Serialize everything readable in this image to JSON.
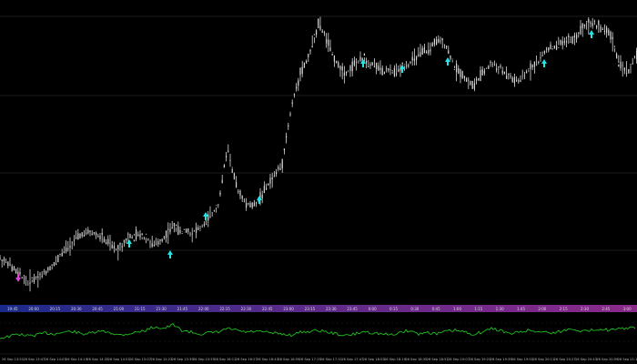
{
  "window": {
    "title": ""
  },
  "colors": {
    "background": "#000000",
    "grid": "#3a3a3a",
    "candle": "#d9d9d9",
    "signal_up": "#22e6e6",
    "signal_down": "#e040e0",
    "oscillator": "#1fbf1f",
    "timeband_start": "#1a2a8a",
    "timeband_end": "#8a2a8a",
    "axis_text": "#bbbbbb"
  },
  "chart_data": [
    {
      "type": "line",
      "title": "",
      "series": [
        {
          "x": [
            0,
            10,
            20,
            30,
            40,
            50,
            60,
            70,
            80,
            90,
            100,
            110,
            120,
            130,
            140,
            150,
            160,
            170,
            180,
            190,
            200,
            210,
            220,
            230,
            240,
            250,
            260,
            270,
            280,
            290,
            300,
            310,
            320,
            330,
            340,
            350,
            360,
            370,
            380,
            390,
            400,
            410,
            420,
            430,
            440,
            450,
            460,
            470,
            480,
            490,
            500,
            510,
            520,
            530,
            540,
            550,
            560,
            570,
            580,
            590,
            600,
            610,
            620,
            630,
            640,
            650,
            660,
            670,
            680,
            690,
            699
          ],
          "y": [
            285,
            290,
            300,
            310,
            305,
            300,
            290,
            275,
            265,
            258,
            256,
            260,
            268,
            275,
            262,
            258,
            262,
            270,
            262,
            248,
            255,
            255,
            250,
            240,
            225,
            160,
            205,
            225,
            225,
            210,
            195,
            180,
            120,
            80,
            60,
            25,
            45,
            70,
            80,
            70,
            65,
            70,
            78,
            80,
            75,
            70,
            60,
            55,
            45,
            50,
            75,
            85,
            95,
            80,
            70,
            75,
            85,
            90,
            78,
            70,
            55,
            50,
            45,
            45,
            30,
            25,
            30,
            35,
            70,
            80,
            60
          ]
        }
      ],
      "ylim": [
        0,
        330
      ]
    },
    {
      "type": "line",
      "title": "",
      "series": [
        {
          "x": [
            0,
            10,
            20,
            30,
            40,
            50,
            60,
            70,
            80,
            90,
            100,
            110,
            120,
            130,
            140,
            150,
            160,
            170,
            180,
            190,
            200,
            210,
            220,
            230,
            240,
            250,
            260,
            270,
            280,
            290,
            300,
            310,
            320,
            330,
            340,
            350,
            360,
            370,
            380,
            390,
            400,
            410,
            420,
            430,
            440,
            450,
            460,
            470,
            480,
            490,
            500,
            510,
            520,
            530,
            540,
            550,
            560,
            570,
            580,
            590,
            600,
            610,
            620,
            630,
            640,
            650,
            660,
            670,
            680,
            690,
            699
          ],
          "y": [
            66,
            62,
            55,
            60,
            58,
            52,
            55,
            50,
            48,
            55,
            53,
            48,
            50,
            58,
            55,
            50,
            45,
            35,
            40,
            30,
            45,
            50,
            55,
            52,
            50,
            40,
            45,
            50,
            48,
            50,
            53,
            55,
            58,
            50,
            48,
            45,
            50,
            55,
            60,
            55,
            48,
            52,
            55,
            58,
            50,
            45,
            55,
            50,
            55,
            48,
            45,
            50,
            55,
            50,
            40,
            45,
            55,
            50,
            45,
            48,
            50,
            52,
            45,
            40,
            48,
            45,
            40,
            45,
            42,
            38,
            40
          ]
        }
      ],
      "ylim": [
        0,
        100
      ]
    }
  ],
  "signals": {
    "up_arrows": [
      {
        "x": 142,
        "y": 268
      },
      {
        "x": 187,
        "y": 280
      },
      {
        "x": 226,
        "y": 238
      },
      {
        "x": 285,
        "y": 220
      },
      {
        "x": 399,
        "y": 70
      },
      {
        "x": 442,
        "y": 76
      },
      {
        "x": 492,
        "y": 68
      },
      {
        "x": 598,
        "y": 70
      },
      {
        "x": 650,
        "y": 38
      }
    ],
    "down_arrows": [
      {
        "x": 20,
        "y": 305
      }
    ]
  },
  "time_axis": {
    "labels": [
      "26 Sep 13:51",
      "26 Sep 13:47",
      "26 Sep 14:03",
      "26 Sep 14:19",
      "26 Sep 14:35",
      "26 Sep 14:51",
      "26 Sep 15:07",
      "26 Sep 15:23",
      "26 Sep 15:39",
      "26 Sep 15:55",
      "26 Sep 16:11",
      "26 Sep 16:27",
      "26 Sep 16:43",
      "26 Sep 16:59",
      "26 Sep 17:15",
      "26 Sep 17:31",
      "26 Sep 17:47",
      "26 Sep 18:03",
      "26 Sep 18:19",
      "26 Sep 18:35",
      "26 Sep 18:51",
      "26 Sep 19:07",
      "26 Sep 19:23",
      "26 Sep 19:39",
      "26 Sep 19:55",
      "26 Sep 20:11",
      "26 Sep 20:27",
      "26 Sep 20:43",
      "26 Sep 20:59",
      "26 Sep 21:15"
    ]
  },
  "hour_band": {
    "labels": [
      "19:45",
      "20:00",
      "20:15",
      "20:30",
      "20:45",
      "21:00",
      "21:15",
      "21:30",
      "21:45",
      "22:00",
      "22:15",
      "22:30",
      "22:45",
      "23:00",
      "23:15",
      "23:30",
      "23:45",
      "0:00",
      "0:15",
      "0:30",
      "0:45",
      "1:00",
      "1:15",
      "1:30",
      "1:45",
      "2:00",
      "2:15",
      "2:30",
      "2:45",
      "3:00"
    ]
  }
}
